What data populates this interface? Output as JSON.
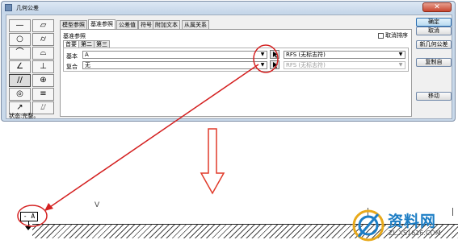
{
  "window": {
    "title": "几何公差",
    "close_label": "✕"
  },
  "tabs": [
    "模型参照",
    "基准参照",
    "公差值",
    "符号",
    "附加文本",
    "从属关系"
  ],
  "panel": {
    "title": "基准参照",
    "cancel_sort_label": "取消排序",
    "subtabs": [
      "首要",
      "第二",
      "第三"
    ],
    "rows": [
      {
        "label": "基本",
        "value": "A",
        "rfs": "RFS (无标志符)"
      },
      {
        "label": "复合",
        "value": "无",
        "rfs": "RFS (无标志符)"
      }
    ]
  },
  "buttons": [
    "确定",
    "取消",
    "新几何公差",
    "复制自",
    "移动"
  ],
  "status": "状态:完整。",
  "symbols": [
    "—",
    "▱",
    "○",
    "⌭",
    "⌒",
    "⌓",
    "∠",
    "⊥",
    "//",
    "⊕",
    "◎",
    "≡",
    "↗",
    "⌰"
  ],
  "drawing": {
    "datum_label": "- A -",
    "v_mark": "V"
  },
  "watermark": {
    "text": "资料网",
    "url": "ZL.XS1616.COM"
  },
  "colors": {
    "arrow": "#d42020",
    "highlight_circle": "#d42020",
    "down_arrow": "#e03a2a",
    "watermark": "#1d7ec5"
  }
}
